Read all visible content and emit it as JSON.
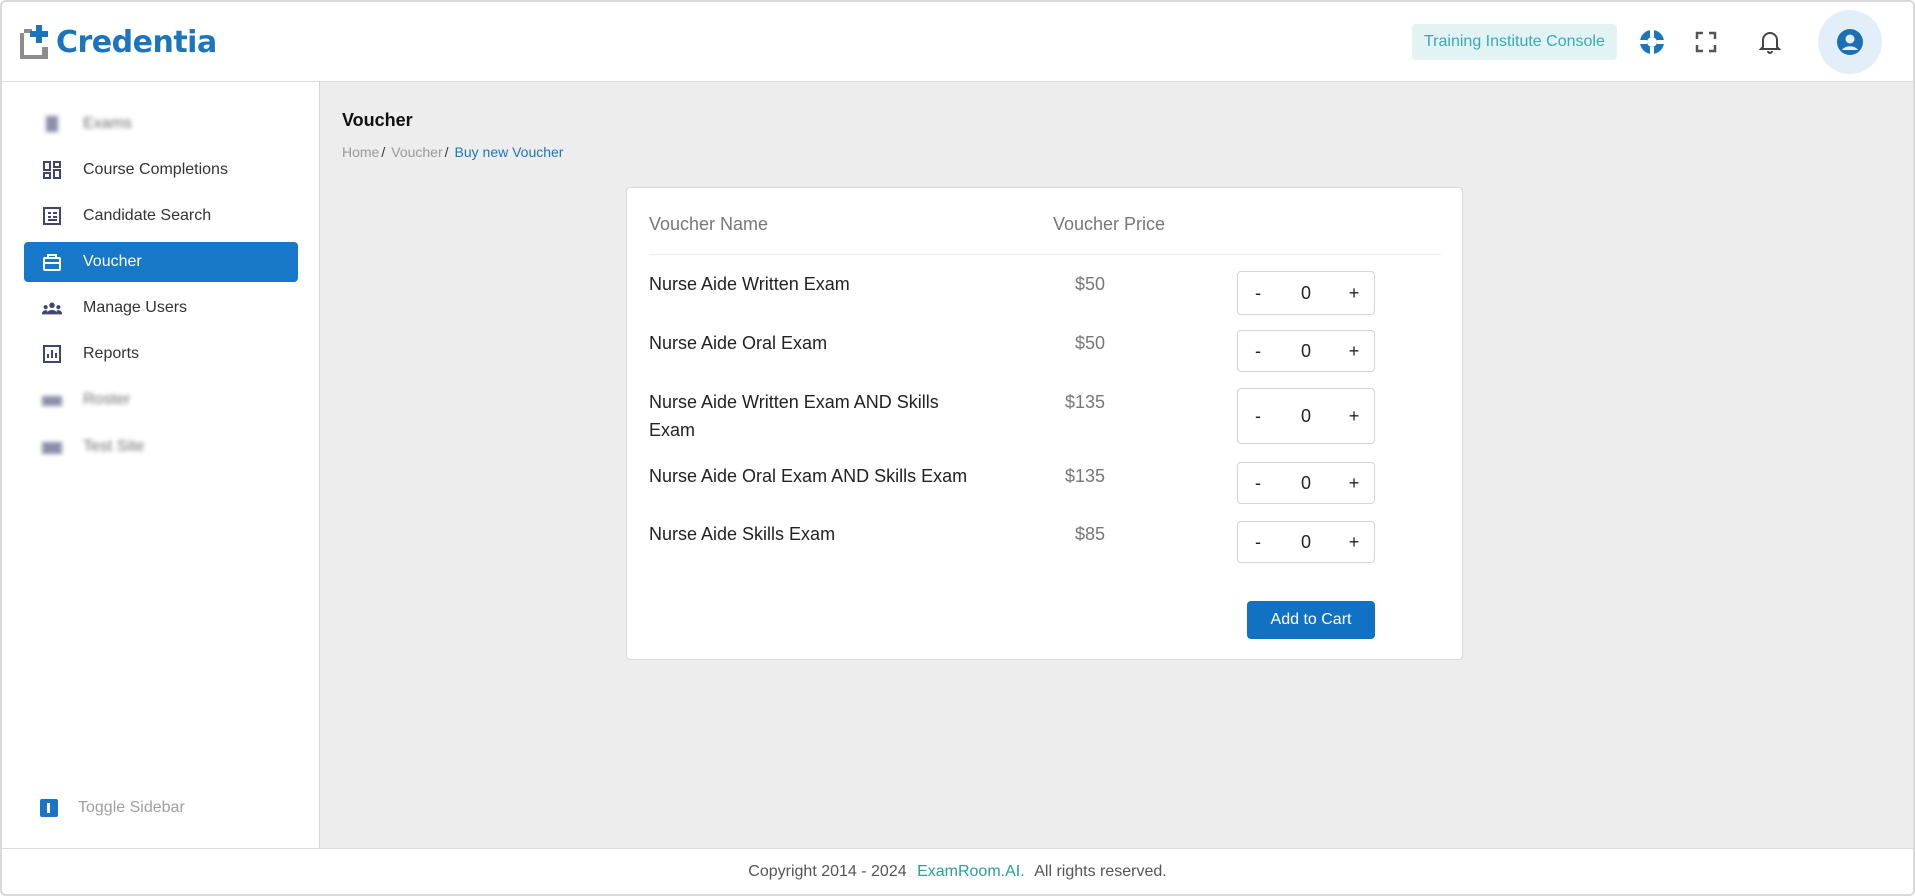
{
  "header": {
    "logo_text": "Credentia",
    "console_badge": "Training Institute Console",
    "icons": [
      "support-icon",
      "fullscreen-icon",
      "bell-icon",
      "account-icon"
    ]
  },
  "sidebar": {
    "items": [
      {
        "label": "Exams",
        "icon": "book-icon",
        "blurred": true
      },
      {
        "label": "Course Completions",
        "icon": "dashboard-icon"
      },
      {
        "label": "Candidate Search",
        "icon": "candidate-search-icon"
      },
      {
        "label": "Voucher",
        "icon": "voucher-icon",
        "active": true
      },
      {
        "label": "Manage Users",
        "icon": "users-icon"
      },
      {
        "label": "Reports",
        "icon": "reports-icon"
      },
      {
        "label": "Roster",
        "icon": "roster-icon",
        "blurred": true
      },
      {
        "label": "Test Site",
        "icon": "test-site-icon",
        "blurred": true
      }
    ],
    "toggle_label": "Toggle Sidebar"
  },
  "main": {
    "title": "Voucher",
    "breadcrumb": [
      "Home",
      "Voucher",
      "Buy new Voucher"
    ],
    "table": {
      "headers": [
        "Voucher Name",
        "Voucher Price"
      ],
      "rows": [
        {
          "name": "Nurse Aide Written Exam",
          "price": "$50",
          "qty": "0"
        },
        {
          "name": "Nurse Aide Oral Exam",
          "price": "$50",
          "qty": "0"
        },
        {
          "name": "Nurse Aide Written Exam AND Skills Exam",
          "price": "$135",
          "qty": "0"
        },
        {
          "name": "Nurse Aide Oral Exam AND Skills Exam",
          "price": "$135",
          "qty": "0"
        },
        {
          "name": "Nurse Aide Skills Exam",
          "price": "$85",
          "qty": "0"
        }
      ],
      "minus_label": "-",
      "plus_label": "+"
    },
    "add_to_cart_label": "Add to Cart"
  },
  "footer": {
    "prefix": "Copyright 2014 - 2024",
    "brand": "ExamRoom.AI.",
    "suffix": "All rights reserved."
  },
  "colors": {
    "accent": "#1777c9",
    "brand_teal": "#2a9d9c",
    "badge_bg": "#e3f3f3",
    "badge_text": "#36a9b8",
    "main_bg": "#ededed"
  }
}
